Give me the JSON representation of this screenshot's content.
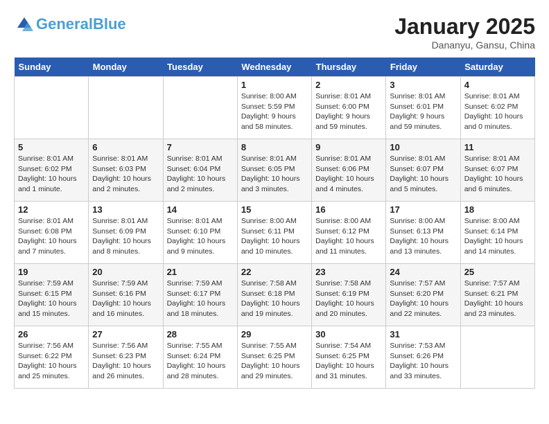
{
  "header": {
    "logo_general": "General",
    "logo_blue": "Blue",
    "month": "January 2025",
    "location": "Dananyu, Gansu, China"
  },
  "weekdays": [
    "Sunday",
    "Monday",
    "Tuesday",
    "Wednesday",
    "Thursday",
    "Friday",
    "Saturday"
  ],
  "weeks": [
    [
      {
        "day": "",
        "info": ""
      },
      {
        "day": "",
        "info": ""
      },
      {
        "day": "",
        "info": ""
      },
      {
        "day": "1",
        "info": "Sunrise: 8:00 AM\nSunset: 5:59 PM\nDaylight: 9 hours\nand 58 minutes."
      },
      {
        "day": "2",
        "info": "Sunrise: 8:01 AM\nSunset: 6:00 PM\nDaylight: 9 hours\nand 59 minutes."
      },
      {
        "day": "3",
        "info": "Sunrise: 8:01 AM\nSunset: 6:01 PM\nDaylight: 9 hours\nand 59 minutes."
      },
      {
        "day": "4",
        "info": "Sunrise: 8:01 AM\nSunset: 6:02 PM\nDaylight: 10 hours\nand 0 minutes."
      }
    ],
    [
      {
        "day": "5",
        "info": "Sunrise: 8:01 AM\nSunset: 6:02 PM\nDaylight: 10 hours\nand 1 minute."
      },
      {
        "day": "6",
        "info": "Sunrise: 8:01 AM\nSunset: 6:03 PM\nDaylight: 10 hours\nand 2 minutes."
      },
      {
        "day": "7",
        "info": "Sunrise: 8:01 AM\nSunset: 6:04 PM\nDaylight: 10 hours\nand 2 minutes."
      },
      {
        "day": "8",
        "info": "Sunrise: 8:01 AM\nSunset: 6:05 PM\nDaylight: 10 hours\nand 3 minutes."
      },
      {
        "day": "9",
        "info": "Sunrise: 8:01 AM\nSunset: 6:06 PM\nDaylight: 10 hours\nand 4 minutes."
      },
      {
        "day": "10",
        "info": "Sunrise: 8:01 AM\nSunset: 6:07 PM\nDaylight: 10 hours\nand 5 minutes."
      },
      {
        "day": "11",
        "info": "Sunrise: 8:01 AM\nSunset: 6:07 PM\nDaylight: 10 hours\nand 6 minutes."
      }
    ],
    [
      {
        "day": "12",
        "info": "Sunrise: 8:01 AM\nSunset: 6:08 PM\nDaylight: 10 hours\nand 7 minutes."
      },
      {
        "day": "13",
        "info": "Sunrise: 8:01 AM\nSunset: 6:09 PM\nDaylight: 10 hours\nand 8 minutes."
      },
      {
        "day": "14",
        "info": "Sunrise: 8:01 AM\nSunset: 6:10 PM\nDaylight: 10 hours\nand 9 minutes."
      },
      {
        "day": "15",
        "info": "Sunrise: 8:00 AM\nSunset: 6:11 PM\nDaylight: 10 hours\nand 10 minutes."
      },
      {
        "day": "16",
        "info": "Sunrise: 8:00 AM\nSunset: 6:12 PM\nDaylight: 10 hours\nand 11 minutes."
      },
      {
        "day": "17",
        "info": "Sunrise: 8:00 AM\nSunset: 6:13 PM\nDaylight: 10 hours\nand 13 minutes."
      },
      {
        "day": "18",
        "info": "Sunrise: 8:00 AM\nSunset: 6:14 PM\nDaylight: 10 hours\nand 14 minutes."
      }
    ],
    [
      {
        "day": "19",
        "info": "Sunrise: 7:59 AM\nSunset: 6:15 PM\nDaylight: 10 hours\nand 15 minutes."
      },
      {
        "day": "20",
        "info": "Sunrise: 7:59 AM\nSunset: 6:16 PM\nDaylight: 10 hours\nand 16 minutes."
      },
      {
        "day": "21",
        "info": "Sunrise: 7:59 AM\nSunset: 6:17 PM\nDaylight: 10 hours\nand 18 minutes."
      },
      {
        "day": "22",
        "info": "Sunrise: 7:58 AM\nSunset: 6:18 PM\nDaylight: 10 hours\nand 19 minutes."
      },
      {
        "day": "23",
        "info": "Sunrise: 7:58 AM\nSunset: 6:19 PM\nDaylight: 10 hours\nand 20 minutes."
      },
      {
        "day": "24",
        "info": "Sunrise: 7:57 AM\nSunset: 6:20 PM\nDaylight: 10 hours\nand 22 minutes."
      },
      {
        "day": "25",
        "info": "Sunrise: 7:57 AM\nSunset: 6:21 PM\nDaylight: 10 hours\nand 23 minutes."
      }
    ],
    [
      {
        "day": "26",
        "info": "Sunrise: 7:56 AM\nSunset: 6:22 PM\nDaylight: 10 hours\nand 25 minutes."
      },
      {
        "day": "27",
        "info": "Sunrise: 7:56 AM\nSunset: 6:23 PM\nDaylight: 10 hours\nand 26 minutes."
      },
      {
        "day": "28",
        "info": "Sunrise: 7:55 AM\nSunset: 6:24 PM\nDaylight: 10 hours\nand 28 minutes."
      },
      {
        "day": "29",
        "info": "Sunrise: 7:55 AM\nSunset: 6:25 PM\nDaylight: 10 hours\nand 29 minutes."
      },
      {
        "day": "30",
        "info": "Sunrise: 7:54 AM\nSunset: 6:25 PM\nDaylight: 10 hours\nand 31 minutes."
      },
      {
        "day": "31",
        "info": "Sunrise: 7:53 AM\nSunset: 6:26 PM\nDaylight: 10 hours\nand 33 minutes."
      },
      {
        "day": "",
        "info": ""
      }
    ]
  ]
}
